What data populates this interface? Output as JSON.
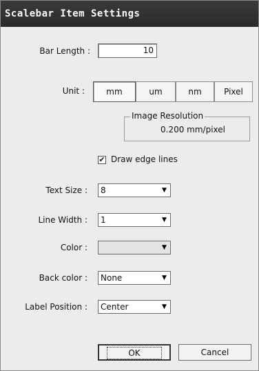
{
  "window": {
    "title": "Scalebar Item Settings"
  },
  "bar_length": {
    "label": "Bar Length :",
    "value": "10"
  },
  "unit": {
    "label": "Unit :",
    "options": [
      "mm",
      "um",
      "nm",
      "Pixel"
    ],
    "selected": "mm"
  },
  "image_resolution": {
    "title": "Image Resolution",
    "value": "0.200  mm/pixel"
  },
  "draw_edge_lines": {
    "label": "Draw edge lines",
    "checked": true,
    "mark": "✔"
  },
  "text_size": {
    "label": "Text Size :",
    "value": "8"
  },
  "line_width": {
    "label": "Line Width :",
    "value": "1"
  },
  "color": {
    "label": "Color :",
    "value": ""
  },
  "back_color": {
    "label": "Back color :",
    "value": "None"
  },
  "label_position": {
    "label": "Label Position :",
    "value": "Center"
  },
  "buttons": {
    "ok": "OK",
    "cancel": "Cancel"
  },
  "icons": {
    "dropdown": "chevron-down-icon",
    "check": "checkmark-icon"
  }
}
